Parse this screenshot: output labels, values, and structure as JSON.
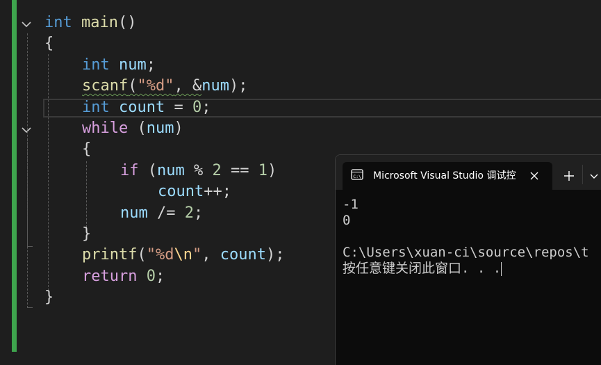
{
  "editor": {
    "lines": [
      {
        "parts": [
          {
            "t": "int",
            "c": "kw"
          },
          {
            "t": " ",
            "c": "p"
          },
          {
            "t": "main",
            "c": "fn"
          },
          {
            "t": "()",
            "c": "p"
          }
        ]
      },
      {
        "parts": [
          {
            "t": "{",
            "c": "p"
          }
        ]
      },
      {
        "parts": [
          {
            "t": "int",
            "c": "kw"
          },
          {
            "t": " ",
            "c": "p"
          },
          {
            "t": "num",
            "c": "var"
          },
          {
            "t": ";",
            "c": "p"
          }
        ]
      },
      {
        "parts": [
          {
            "t": "scanf",
            "c": "fn",
            "squiggle": true
          },
          {
            "t": "(",
            "c": "p",
            "squiggle": true
          },
          {
            "t": "\"%d\"",
            "c": "str",
            "squiggle": true
          },
          {
            "t": ", &",
            "c": "p",
            "squiggle": true
          },
          {
            "t": "num",
            "c": "var"
          },
          {
            "t": ");",
            "c": "p"
          }
        ]
      },
      {
        "parts": [
          {
            "t": "int",
            "c": "kw"
          },
          {
            "t": " ",
            "c": "p"
          },
          {
            "t": "count",
            "c": "var"
          },
          {
            "t": " = ",
            "c": "p"
          },
          {
            "t": "0",
            "c": "num"
          },
          {
            "t": ";",
            "c": "p"
          }
        ]
      },
      {
        "parts": [
          {
            "t": "while",
            "c": "ctl"
          },
          {
            "t": " (",
            "c": "p"
          },
          {
            "t": "num",
            "c": "var"
          },
          {
            "t": ")",
            "c": "p"
          }
        ]
      },
      {
        "parts": [
          {
            "t": "{",
            "c": "p"
          }
        ]
      },
      {
        "parts": [
          {
            "t": "if",
            "c": "ctl"
          },
          {
            "t": " (",
            "c": "p"
          },
          {
            "t": "num",
            "c": "var"
          },
          {
            "t": " % ",
            "c": "p"
          },
          {
            "t": "2",
            "c": "num"
          },
          {
            "t": " == ",
            "c": "p"
          },
          {
            "t": "1",
            "c": "num"
          },
          {
            "t": ")",
            "c": "p"
          }
        ]
      },
      {
        "parts": [
          {
            "t": "count",
            "c": "var"
          },
          {
            "t": "++;",
            "c": "p"
          }
        ]
      },
      {
        "parts": [
          {
            "t": "num",
            "c": "var"
          },
          {
            "t": " /= ",
            "c": "p"
          },
          {
            "t": "2",
            "c": "num"
          },
          {
            "t": ";",
            "c": "p"
          }
        ]
      },
      {
        "parts": [
          {
            "t": "}",
            "c": "p"
          }
        ]
      },
      {
        "parts": [
          {
            "t": "printf",
            "c": "fn"
          },
          {
            "t": "(",
            "c": "p"
          },
          {
            "t": "\"%d",
            "c": "str"
          },
          {
            "t": "\\n",
            "c": "esc"
          },
          {
            "t": "\"",
            "c": "str"
          },
          {
            "t": ", ",
            "c": "p"
          },
          {
            "t": "count",
            "c": "var"
          },
          {
            "t": ");",
            "c": "p"
          }
        ]
      },
      {
        "parts": [
          {
            "t": "return",
            "c": "ctl"
          },
          {
            "t": " ",
            "c": "p"
          },
          {
            "t": "0",
            "c": "num"
          },
          {
            "t": ";",
            "c": "p"
          }
        ]
      },
      {
        "parts": [
          {
            "t": "}",
            "c": "p"
          }
        ]
      }
    ]
  },
  "console": {
    "tab_title": "Microsoft Visual Studio 调试控",
    "tab_icon": "terminal-icon",
    "output": [
      "-1",
      "0",
      "",
      "C:\\Users\\xuan-ci\\source\\repos\\t",
      "按任意键关闭此窗口. . ."
    ]
  },
  "colors": {
    "editor_bg": "#1e1e1e",
    "change_bar": "#3ea44d",
    "keyword": "#569cd6",
    "control": "#d8a0df",
    "function": "#dcdcaa",
    "variable": "#9cdcfe",
    "string": "#d69d85",
    "number": "#b5cea8",
    "console_bg": "#0c0c0c"
  }
}
